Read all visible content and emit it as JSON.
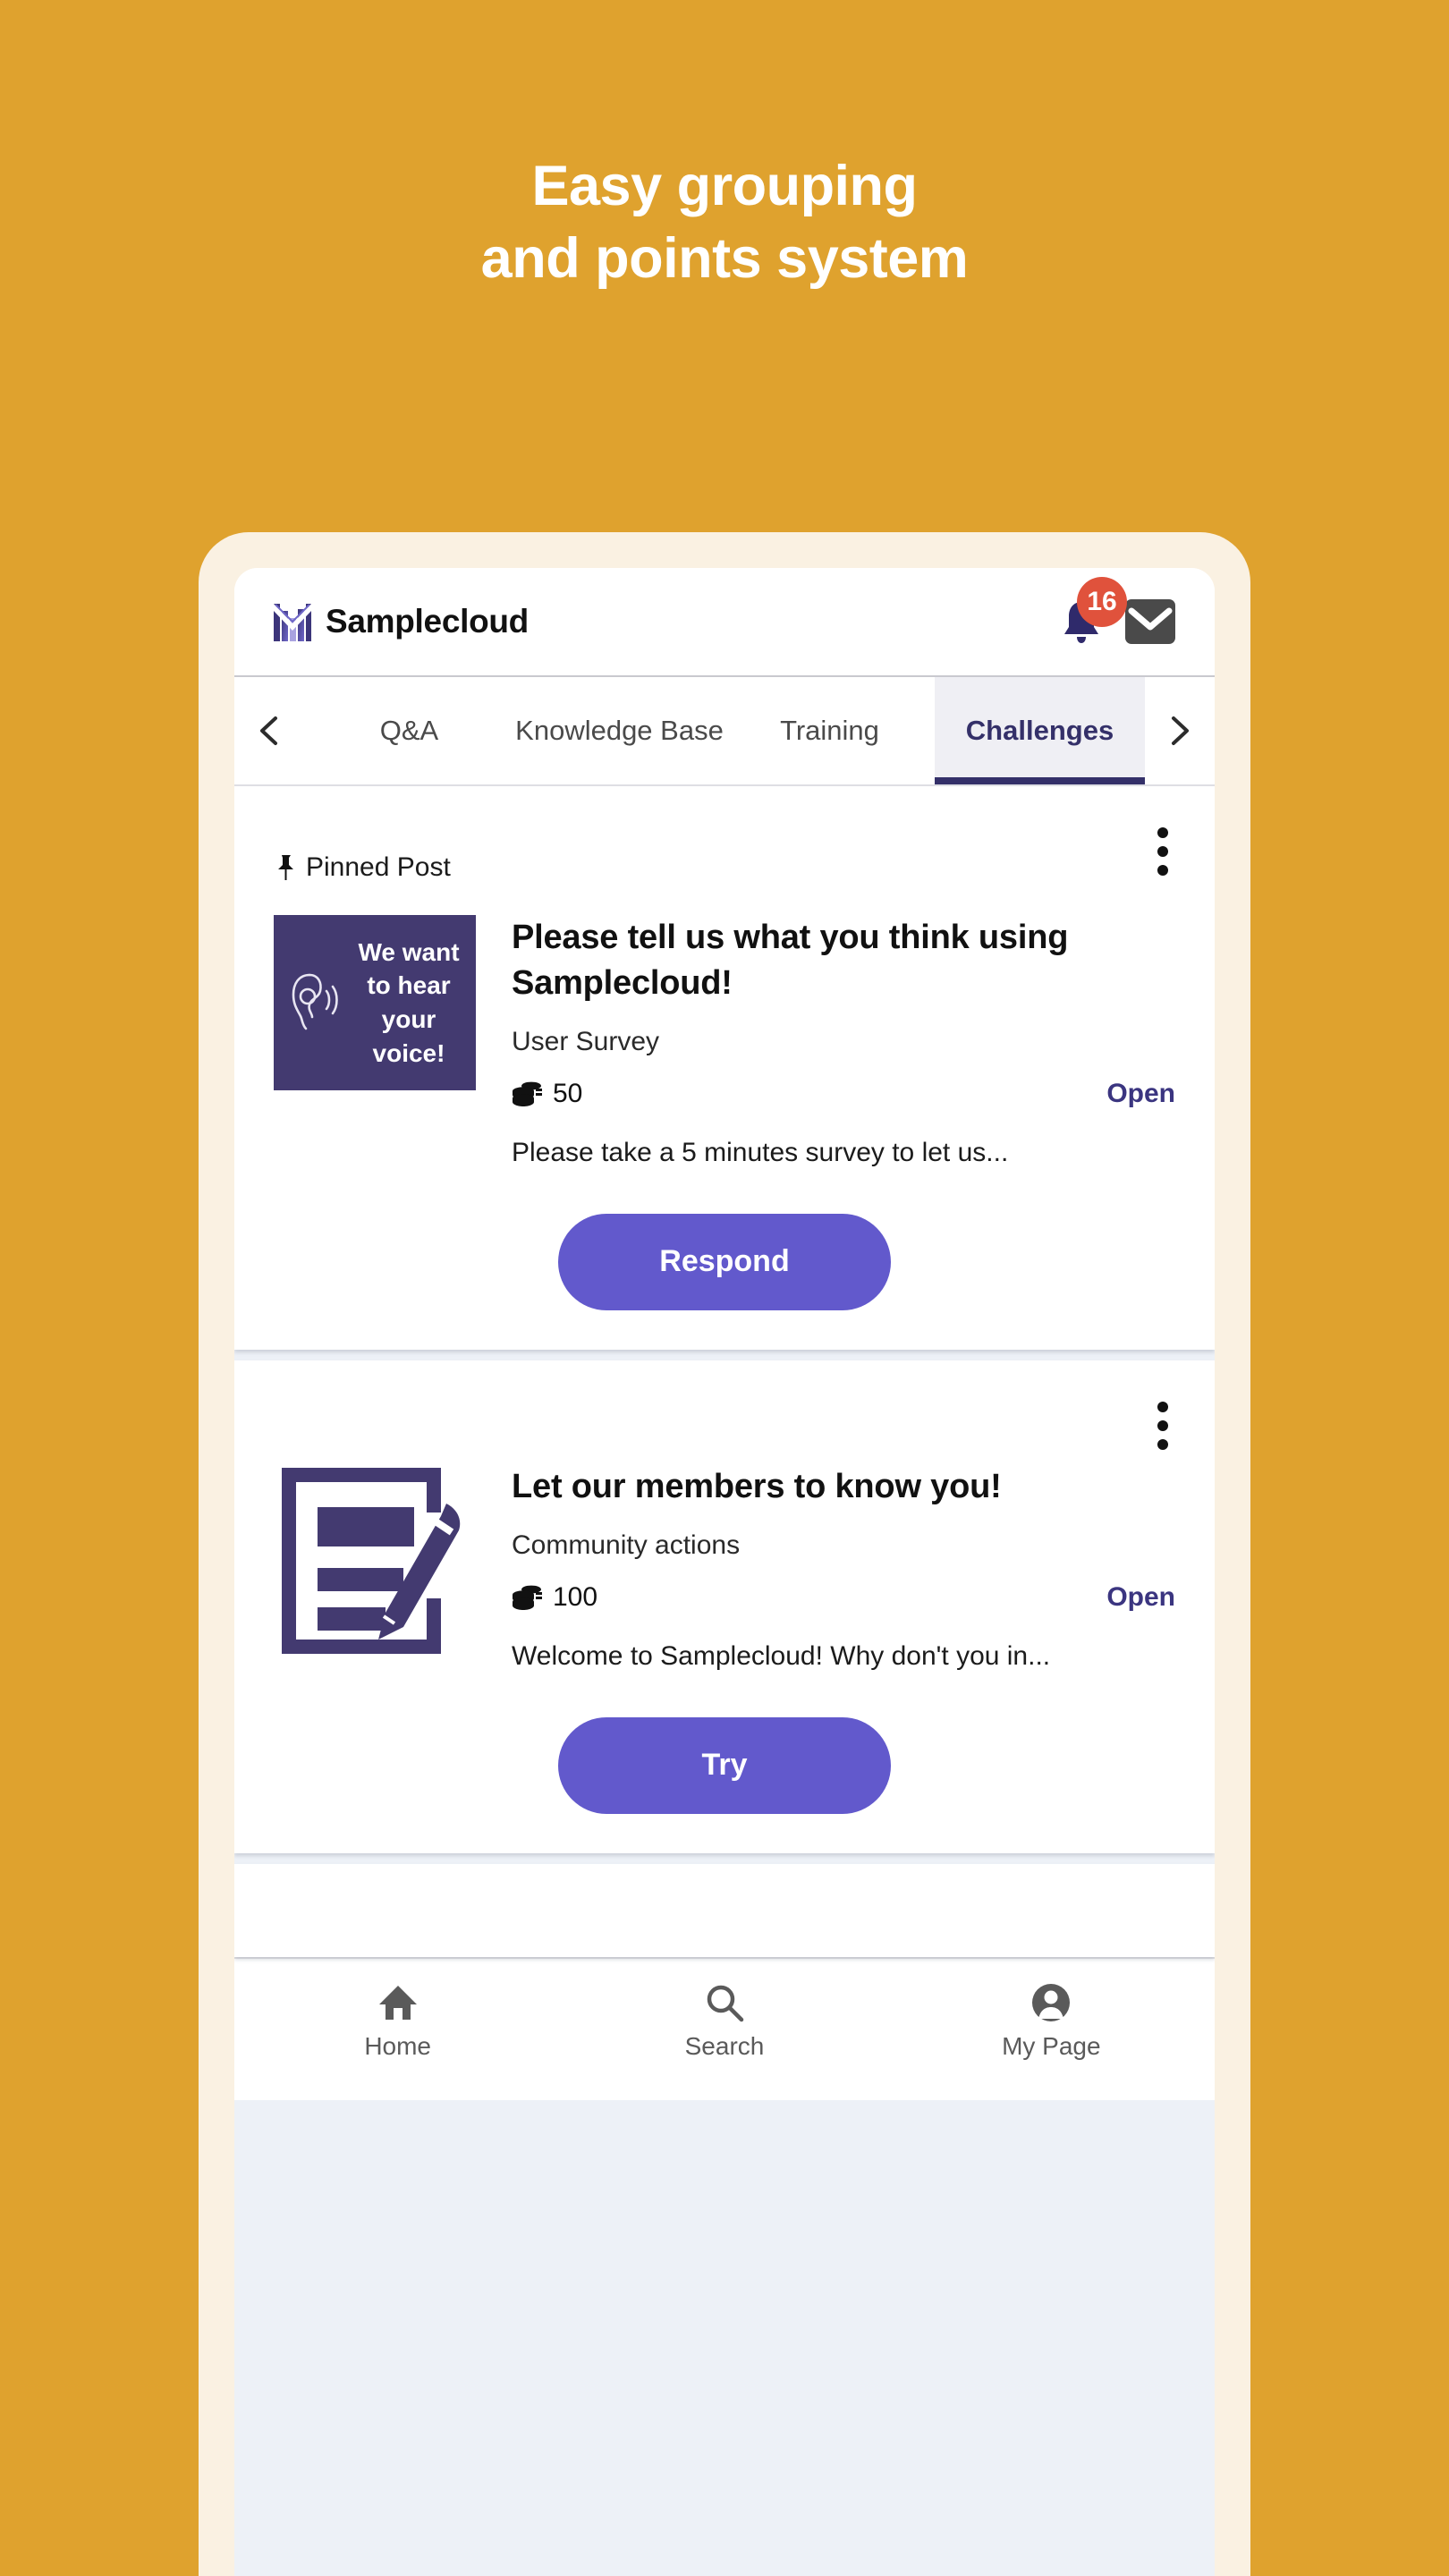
{
  "promo": {
    "headline_line1": "Easy grouping",
    "headline_line2": "and points system",
    "background_color": "#DFA22E",
    "frame_color": "#FAF1E2"
  },
  "app": {
    "brand_name": "Samplecloud",
    "logo_icon": "chart-logo-icon",
    "notification_bell_icon": "bell-icon",
    "notification_count": "16",
    "mail_icon": "mail-icon",
    "accent_color": "#6259CC",
    "dark_purple": "#343069"
  },
  "tabs": {
    "prev_arrow_icon": "chevron-left-icon",
    "next_arrow_icon": "chevron-right-icon",
    "items": [
      {
        "label": "Q&A",
        "active": false
      },
      {
        "label": "Knowledge Base",
        "active": false
      },
      {
        "label": "Training",
        "active": false
      },
      {
        "label": "Challenges",
        "active": true
      }
    ]
  },
  "posts": [
    {
      "pinned_label": "Pinned Post",
      "pin_icon": "pin-icon",
      "menu_icon": "more-vertical-icon",
      "thumbnail_icon": "ear-listening-icon",
      "thumbnail_text": "We want to hear your voice!",
      "title": "Please tell us what you think using Samplecloud!",
      "category": "User Survey",
      "points_icon": "coins-icon",
      "points": "50",
      "status": "Open",
      "description": "Please take a 5 minutes survey to let us...",
      "cta_label": "Respond"
    },
    {
      "menu_icon": "more-vertical-icon",
      "thumbnail_icon": "document-pencil-icon",
      "title": "Let our members to know you!",
      "category": "Community actions",
      "points_icon": "coins-icon",
      "points": "100",
      "status": "Open",
      "description": "Welcome to Samplecloud! Why don't you in...",
      "cta_label": "Try"
    }
  ],
  "bottom_nav": {
    "items": [
      {
        "label": "Home",
        "icon": "home-icon"
      },
      {
        "label": "Search",
        "icon": "search-icon"
      },
      {
        "label": "My Page",
        "icon": "person-icon"
      }
    ]
  }
}
